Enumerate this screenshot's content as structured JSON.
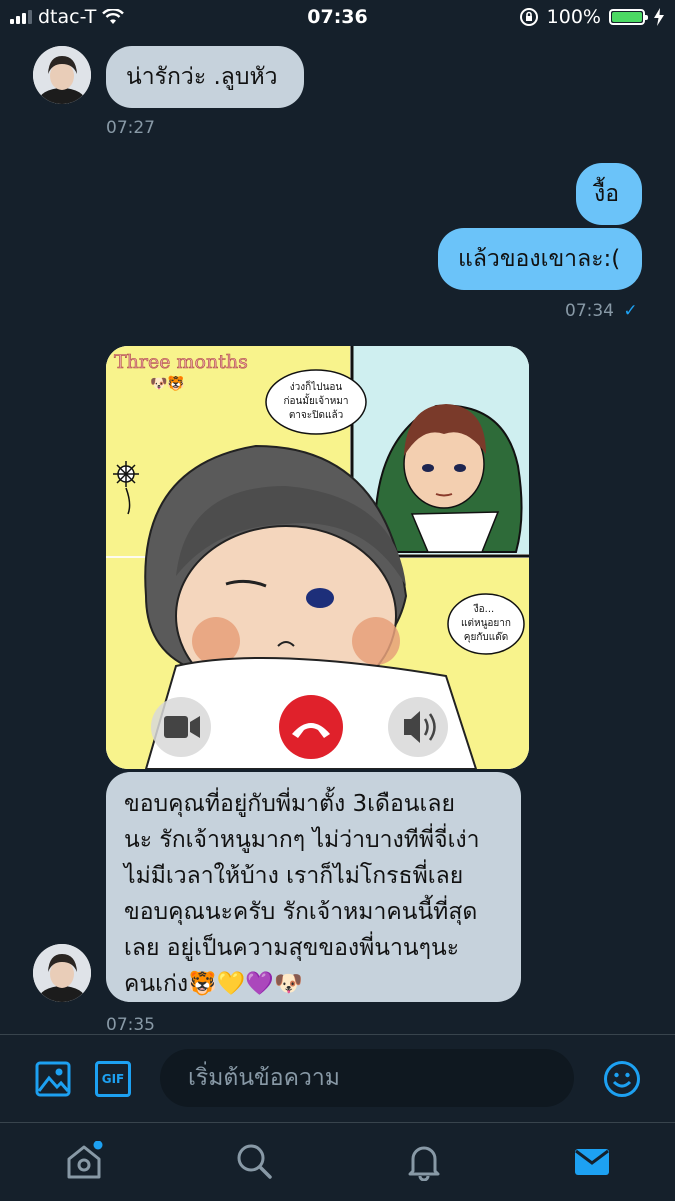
{
  "status_bar": {
    "carrier": "dtac-T",
    "time": "07:36",
    "battery": "100%"
  },
  "messages": [
    {
      "direction": "incoming",
      "text": "น่ารักว่ะ .ลูบหัว",
      "timestamp": "07:27"
    },
    {
      "direction": "outgoing",
      "text": "งื้อ"
    },
    {
      "direction": "outgoing",
      "text": "แล้วของเขาละ:(",
      "timestamp": "07:34",
      "read_mark": "✓"
    },
    {
      "direction": "incoming",
      "image": {
        "title_text": "Three months",
        "speech1": [
          "ง่วงก็ไปนอน",
          "ก่อนมั้ยเจ้าหมา",
          "ตาจะปิดแล้ว"
        ],
        "speech2": [
          "งือ...",
          "แต่หนูอยาก",
          "คุยกับแด๊ด"
        ]
      },
      "text_lines": [
        "ขอบคุณที่อยู่กับพี่มาตั้ง 3เดือนเลย",
        "นะ รักเจ้าหนูมากๆ ไม่ว่าบางทีพี่จี่เง่า",
        "ไม่มีเวลาให้บ้าง เราก็ไม่โกรธพี่เลย",
        "ขอบคุณนะครับ รักเจ้าหมาคนนี้ที่สุด",
        "เลย อยู่เป็นความสุขของพี่นานๆนะ",
        "คนเก่ง🐯💛💜🐶"
      ],
      "timestamp": "07:35"
    }
  ],
  "compose": {
    "placeholder": "เริ่มต้นข้อความ",
    "gif_label": "GIF"
  },
  "tabs": [
    "home-icon",
    "search-icon",
    "bell-icon",
    "mail-icon"
  ],
  "colors": {
    "accent": "#1da1f2",
    "background": "#15202b",
    "incoming": "#c6d2dc",
    "outgoing": "#6bc3f9"
  }
}
